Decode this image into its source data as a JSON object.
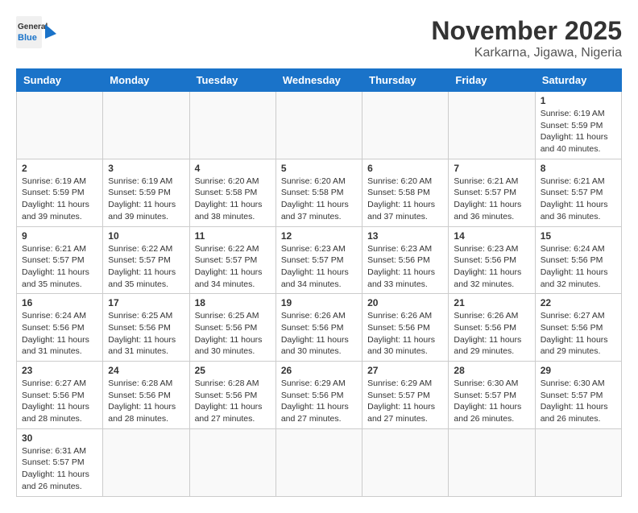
{
  "header": {
    "logo_general": "General",
    "logo_blue": "Blue",
    "month": "November 2025",
    "location": "Karkarna, Jigawa, Nigeria"
  },
  "weekdays": [
    "Sunday",
    "Monday",
    "Tuesday",
    "Wednesday",
    "Thursday",
    "Friday",
    "Saturday"
  ],
  "weeks": [
    [
      {
        "day": "",
        "info": ""
      },
      {
        "day": "",
        "info": ""
      },
      {
        "day": "",
        "info": ""
      },
      {
        "day": "",
        "info": ""
      },
      {
        "day": "",
        "info": ""
      },
      {
        "day": "",
        "info": ""
      },
      {
        "day": "1",
        "info": "Sunrise: 6:19 AM\nSunset: 5:59 PM\nDaylight: 11 hours\nand 40 minutes."
      }
    ],
    [
      {
        "day": "2",
        "info": "Sunrise: 6:19 AM\nSunset: 5:59 PM\nDaylight: 11 hours\nand 39 minutes."
      },
      {
        "day": "3",
        "info": "Sunrise: 6:19 AM\nSunset: 5:59 PM\nDaylight: 11 hours\nand 39 minutes."
      },
      {
        "day": "4",
        "info": "Sunrise: 6:20 AM\nSunset: 5:58 PM\nDaylight: 11 hours\nand 38 minutes."
      },
      {
        "day": "5",
        "info": "Sunrise: 6:20 AM\nSunset: 5:58 PM\nDaylight: 11 hours\nand 37 minutes."
      },
      {
        "day": "6",
        "info": "Sunrise: 6:20 AM\nSunset: 5:58 PM\nDaylight: 11 hours\nand 37 minutes."
      },
      {
        "day": "7",
        "info": "Sunrise: 6:21 AM\nSunset: 5:57 PM\nDaylight: 11 hours\nand 36 minutes."
      },
      {
        "day": "8",
        "info": "Sunrise: 6:21 AM\nSunset: 5:57 PM\nDaylight: 11 hours\nand 36 minutes."
      }
    ],
    [
      {
        "day": "9",
        "info": "Sunrise: 6:21 AM\nSunset: 5:57 PM\nDaylight: 11 hours\nand 35 minutes."
      },
      {
        "day": "10",
        "info": "Sunrise: 6:22 AM\nSunset: 5:57 PM\nDaylight: 11 hours\nand 35 minutes."
      },
      {
        "day": "11",
        "info": "Sunrise: 6:22 AM\nSunset: 5:57 PM\nDaylight: 11 hours\nand 34 minutes."
      },
      {
        "day": "12",
        "info": "Sunrise: 6:23 AM\nSunset: 5:57 PM\nDaylight: 11 hours\nand 34 minutes."
      },
      {
        "day": "13",
        "info": "Sunrise: 6:23 AM\nSunset: 5:56 PM\nDaylight: 11 hours\nand 33 minutes."
      },
      {
        "day": "14",
        "info": "Sunrise: 6:23 AM\nSunset: 5:56 PM\nDaylight: 11 hours\nand 32 minutes."
      },
      {
        "day": "15",
        "info": "Sunrise: 6:24 AM\nSunset: 5:56 PM\nDaylight: 11 hours\nand 32 minutes."
      }
    ],
    [
      {
        "day": "16",
        "info": "Sunrise: 6:24 AM\nSunset: 5:56 PM\nDaylight: 11 hours\nand 31 minutes."
      },
      {
        "day": "17",
        "info": "Sunrise: 6:25 AM\nSunset: 5:56 PM\nDaylight: 11 hours\nand 31 minutes."
      },
      {
        "day": "18",
        "info": "Sunrise: 6:25 AM\nSunset: 5:56 PM\nDaylight: 11 hours\nand 30 minutes."
      },
      {
        "day": "19",
        "info": "Sunrise: 6:26 AM\nSunset: 5:56 PM\nDaylight: 11 hours\nand 30 minutes."
      },
      {
        "day": "20",
        "info": "Sunrise: 6:26 AM\nSunset: 5:56 PM\nDaylight: 11 hours\nand 30 minutes."
      },
      {
        "day": "21",
        "info": "Sunrise: 6:26 AM\nSunset: 5:56 PM\nDaylight: 11 hours\nand 29 minutes."
      },
      {
        "day": "22",
        "info": "Sunrise: 6:27 AM\nSunset: 5:56 PM\nDaylight: 11 hours\nand 29 minutes."
      }
    ],
    [
      {
        "day": "23",
        "info": "Sunrise: 6:27 AM\nSunset: 5:56 PM\nDaylight: 11 hours\nand 28 minutes."
      },
      {
        "day": "24",
        "info": "Sunrise: 6:28 AM\nSunset: 5:56 PM\nDaylight: 11 hours\nand 28 minutes."
      },
      {
        "day": "25",
        "info": "Sunrise: 6:28 AM\nSunset: 5:56 PM\nDaylight: 11 hours\nand 27 minutes."
      },
      {
        "day": "26",
        "info": "Sunrise: 6:29 AM\nSunset: 5:56 PM\nDaylight: 11 hours\nand 27 minutes."
      },
      {
        "day": "27",
        "info": "Sunrise: 6:29 AM\nSunset: 5:57 PM\nDaylight: 11 hours\nand 27 minutes."
      },
      {
        "day": "28",
        "info": "Sunrise: 6:30 AM\nSunset: 5:57 PM\nDaylight: 11 hours\nand 26 minutes."
      },
      {
        "day": "29",
        "info": "Sunrise: 6:30 AM\nSunset: 5:57 PM\nDaylight: 11 hours\nand 26 minutes."
      }
    ],
    [
      {
        "day": "30",
        "info": "Sunrise: 6:31 AM\nSunset: 5:57 PM\nDaylight: 11 hours\nand 26 minutes."
      },
      {
        "day": "",
        "info": ""
      },
      {
        "day": "",
        "info": ""
      },
      {
        "day": "",
        "info": ""
      },
      {
        "day": "",
        "info": ""
      },
      {
        "day": "",
        "info": ""
      },
      {
        "day": "",
        "info": ""
      }
    ]
  ]
}
